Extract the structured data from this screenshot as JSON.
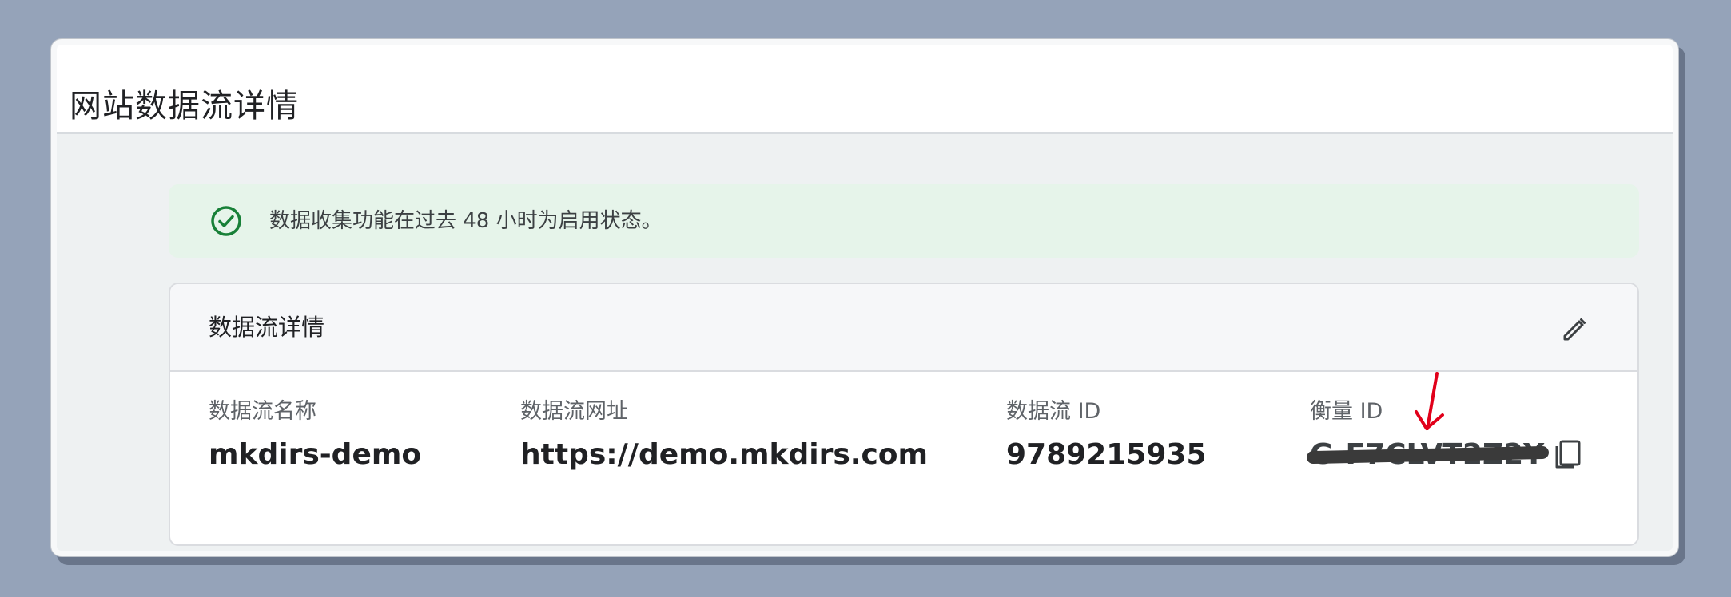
{
  "page": {
    "title": "网站数据流详情"
  },
  "banner": {
    "text": "数据收集功能在过去 48 小时为启用状态。",
    "icon": "check-circle-icon",
    "color": "#188038"
  },
  "stream_card": {
    "title": "数据流详情",
    "edit_icon": "pencil-icon",
    "copy_icon": "copy-icon",
    "fields": {
      "name": {
        "label": "数据流名称",
        "value": "mkdirs-demo"
      },
      "url": {
        "label": "数据流网址",
        "value": "https://demo.mkdirs.com"
      },
      "stream_id": {
        "label": "数据流 ID",
        "value": "9789215935"
      },
      "measurement_id": {
        "label": "衡量 ID",
        "value": "G-F7CLVT2Z2Y",
        "redacted": true
      }
    }
  },
  "annotation": {
    "type": "arrow",
    "color": "#e1001a"
  },
  "colors": {
    "background": "#95a3b9",
    "banner_bg": "#e6f4ea",
    "text_primary": "#202124",
    "text_secondary": "#5f6368"
  }
}
